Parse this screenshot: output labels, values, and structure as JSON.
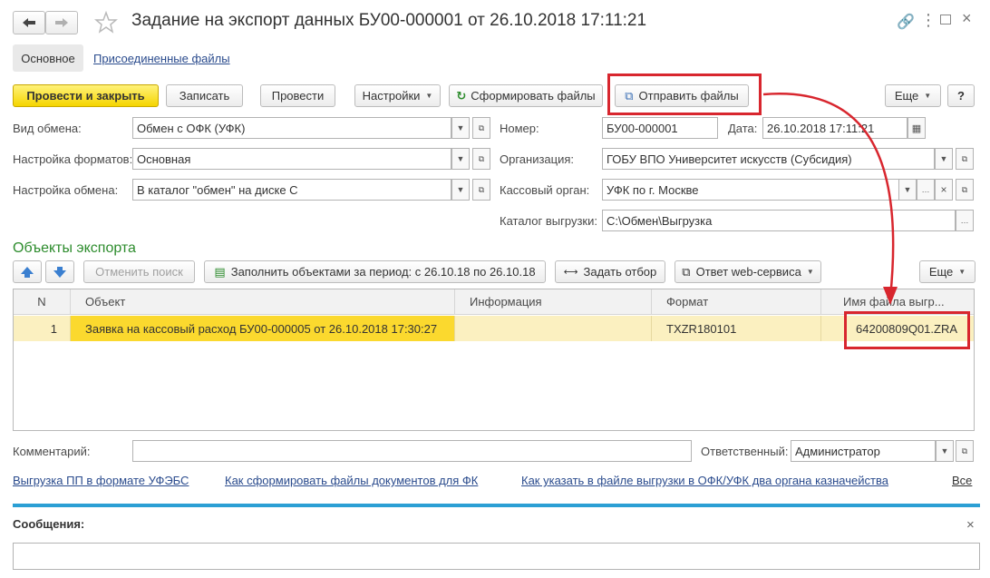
{
  "window": {
    "title": "Задание на экспорт данных БУ00-000001 от 26.10.2018 17:11:21",
    "tabs": [
      "Основное",
      "Присоединенные файлы"
    ]
  },
  "toolbar": {
    "post_close": "Провести и закрыть",
    "save": "Записать",
    "post": "Провести",
    "settings": "Настройки",
    "form_files": "Сформировать файлы",
    "send_files": "Отправить файлы",
    "more": "Еще",
    "help": "?"
  },
  "form": {
    "exchange_type_label": "Вид обмена:",
    "exchange_type": "Обмен с ОФК (УФК)",
    "format_label": "Настройка форматов:",
    "format": "Основная",
    "exchange_setup_label": "Настройка обмена:",
    "exchange_setup": "В каталог \"обмен\" на диске С",
    "number_label": "Номер:",
    "number": "БУ00-000001",
    "date_label": "Дата:",
    "date": "26.10.2018 17:11:21",
    "org_label": "Организация:",
    "org": "ГОБУ ВПО Университет искусств (Субсидия)",
    "treasury_label": "Кассовый орган:",
    "treasury": "УФК по г. Москве",
    "folder_label": "Каталог выгрузки:",
    "folder": "C:\\Обмен\\Выгрузка"
  },
  "objects": {
    "title": "Объекты экспорта",
    "cancel_search": "Отменить поиск",
    "fill_period": "Заполнить объектами за период: с 26.10.18 по 26.10.18",
    "set_filter": "Задать отбор",
    "ws_reply": "Ответ web-сервиса",
    "more": "Еще",
    "columns": [
      "N",
      "Объект",
      "Информация",
      "Формат",
      "Имя файла выгр..."
    ],
    "rows": [
      {
        "n": "1",
        "object": "Заявка на кассовый расход БУ00-000005 от 26.10.2018 17:30:27",
        "info": "",
        "format": "TXZR180101",
        "file": "64200809Q01.ZRA"
      }
    ]
  },
  "footer": {
    "comment_label": "Комментарий:",
    "comment": "",
    "responsible_label": "Ответственный:",
    "responsible": "Администратор",
    "links": [
      "Выгрузка ПП в формате УФЭБС",
      "Как сформировать файлы документов для ФК",
      "Как указать в файле выгрузки в ОФК/УФК два органа казначейства"
    ],
    "all": "Все"
  },
  "messages": {
    "title": "Сообщения:"
  },
  "colors": {
    "accent_green": "#2d8c2d",
    "highlight_red": "#d8262e",
    "row_yellow": "#fbd92e",
    "link_blue": "#2a4b8d",
    "divider_blue": "#2b9fd4"
  }
}
